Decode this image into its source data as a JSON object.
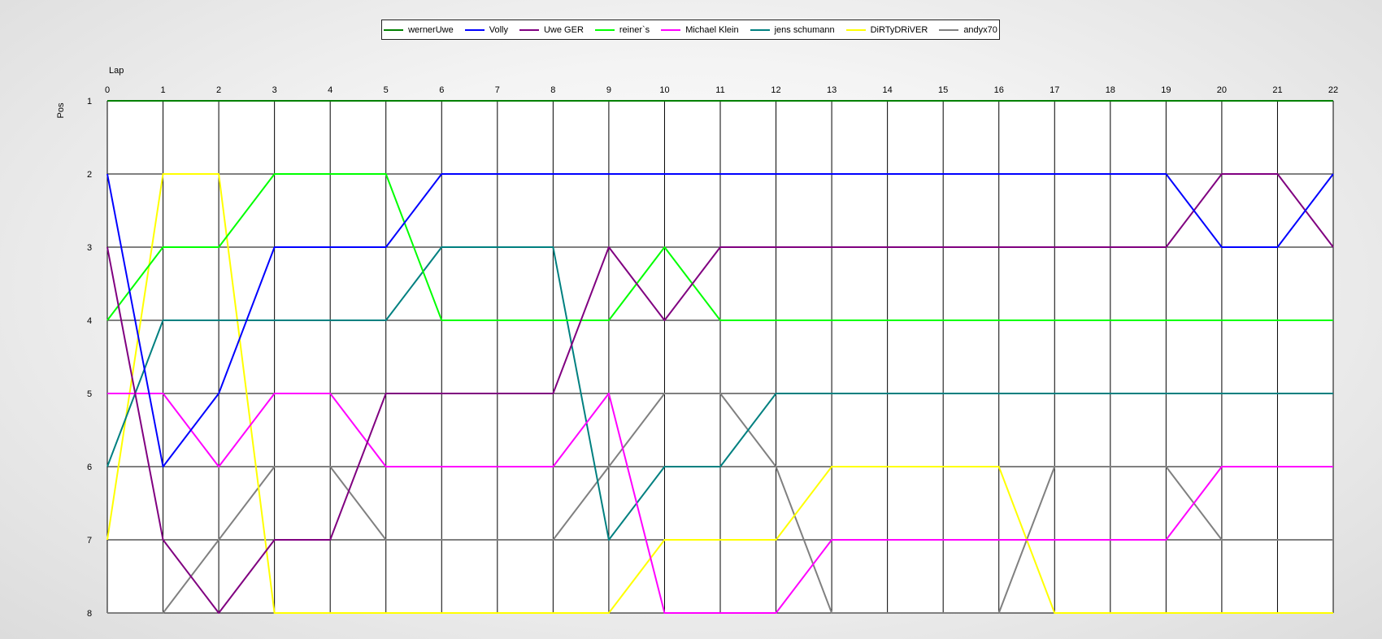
{
  "chart_data": {
    "type": "line",
    "xlabel": "Lap",
    "ylabel": "Pos",
    "xlim": [
      0,
      22
    ],
    "ylim": [
      1,
      8
    ],
    "y_inverted": true,
    "grid": true,
    "legend_position": "top-center",
    "x": [
      0,
      1,
      2,
      3,
      4,
      5,
      6,
      7,
      8,
      9,
      10,
      11,
      12,
      13,
      14,
      15,
      16,
      17,
      18,
      19,
      20,
      21,
      22
    ],
    "series": [
      {
        "name": "wernerUwe",
        "color": "#008000",
        "values": [
          1,
          1,
          1,
          1,
          1,
          1,
          1,
          1,
          1,
          1,
          1,
          1,
          1,
          1,
          1,
          1,
          1,
          1,
          1,
          1,
          1,
          1,
          1
        ]
      },
      {
        "name": "Volly",
        "color": "#0000ff",
        "values": [
          2,
          6,
          5,
          3,
          3,
          3,
          2,
          2,
          2,
          2,
          2,
          2,
          2,
          2,
          2,
          2,
          2,
          2,
          2,
          2,
          3,
          3,
          2
        ]
      },
      {
        "name": "Uwe GER",
        "color": "#800080",
        "values": [
          3,
          7,
          8,
          7,
          7,
          5,
          5,
          5,
          5,
          3,
          4,
          3,
          3,
          3,
          3,
          3,
          3,
          3,
          3,
          3,
          2,
          2,
          3
        ]
      },
      {
        "name": "reiner`s",
        "color": "#00ff00",
        "values": [
          4,
          3,
          3,
          2,
          2,
          2,
          4,
          4,
          4,
          4,
          3,
          4,
          4,
          4,
          4,
          4,
          4,
          4,
          4,
          4,
          4,
          4,
          4
        ]
      },
      {
        "name": "Michael Klein",
        "color": "#ff00ff",
        "values": [
          5,
          5,
          6,
          5,
          5,
          6,
          6,
          6,
          6,
          5,
          8,
          8,
          8,
          7,
          7,
          7,
          7,
          7,
          7,
          7,
          6,
          6,
          6
        ]
      },
      {
        "name": "jens  schumann",
        "color": "#008080",
        "values": [
          6,
          4,
          4,
          4,
          4,
          4,
          3,
          3,
          3,
          7,
          6,
          6,
          5,
          5,
          5,
          5,
          5,
          5,
          5,
          5,
          5,
          5,
          5
        ]
      },
      {
        "name": "DiRTyDRiVER",
        "color": "#ffff00",
        "values": [
          7,
          2,
          2,
          8,
          8,
          8,
          8,
          8,
          8,
          8,
          7,
          7,
          7,
          6,
          6,
          6,
          6,
          8,
          8,
          8,
          8,
          8,
          8
        ]
      },
      {
        "name": "andyx70",
        "color": "#808080",
        "values": [
          8,
          8,
          7,
          6,
          6,
          7,
          7,
          7,
          7,
          6,
          5,
          5,
          6,
          8,
          8,
          8,
          8,
          6,
          6,
          6,
          7,
          7,
          7
        ]
      }
    ]
  }
}
